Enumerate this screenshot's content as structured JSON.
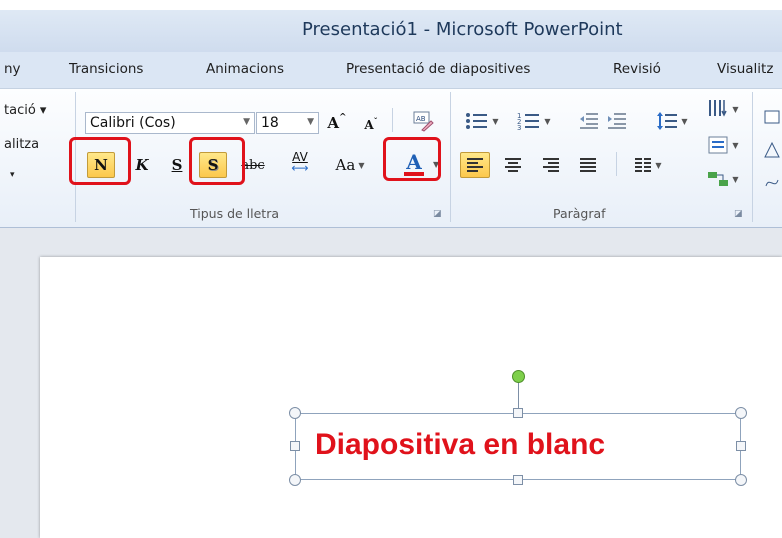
{
  "window": {
    "title": "Presentació1  -  Microsoft PowerPoint"
  },
  "tabs": [
    "ny",
    "Transicions",
    "Animacions",
    "Presentació de diapositives",
    "Revisió",
    "Visualitz"
  ],
  "left_group": {
    "line1": "tació ▾",
    "line2": "alitza",
    "line3": "▾"
  },
  "font_group": {
    "label": "Tipus de lletra",
    "font_name": "Calibri (Cos)",
    "font_size": "18",
    "bold": "N",
    "italic": "K",
    "underline": "S",
    "shadow": "S",
    "strike": "abc",
    "spacing": "AV",
    "case": "Aa",
    "color": "A",
    "grow": "A",
    "shrink": "A"
  },
  "paragraph_group": {
    "label": "Paràgraf"
  },
  "slide": {
    "text": "Diapositiva en blanc"
  },
  "colors": {
    "highlight_box": "#e0121b",
    "active_button": "#fcc84c",
    "slide_text": "#e0121b"
  }
}
